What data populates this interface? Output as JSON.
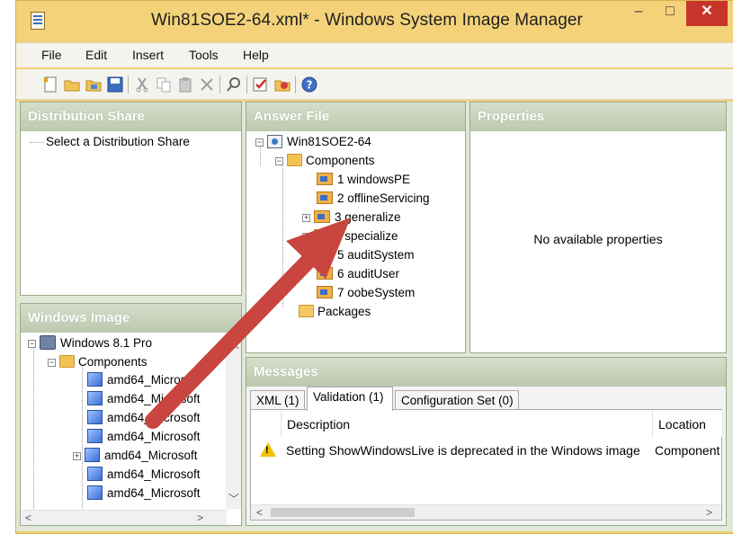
{
  "window": {
    "title": "Win81SOE2-64.xml* - Windows System Image Manager",
    "controls": {
      "minimize": "–",
      "maximize": "□",
      "close": "✕"
    }
  },
  "menu": [
    "File",
    "Edit",
    "Insert",
    "Tools",
    "Help"
  ],
  "toolbar": {
    "icons": [
      "new-answer-file-icon",
      "open-answer-file-icon",
      "open-distribution-share-icon",
      "save-icon",
      "cut-icon",
      "copy-icon",
      "paste-icon",
      "delete-icon",
      "find-icon",
      "validate-icon",
      "create-configuration-set-icon",
      "help-icon"
    ]
  },
  "distribution_share": {
    "header": "Distribution Share",
    "item": "Select a Distribution Share"
  },
  "windows_image": {
    "header": "Windows Image",
    "root": "Windows 8.1 Pro",
    "components_label": "Components",
    "items": [
      "amd64_Microsoft",
      "amd64_Microsoft",
      "amd64_Microsoft",
      "amd64_Microsoft",
      "amd64_Microsoft",
      "amd64_Microsoft",
      "amd64_Microsoft"
    ]
  },
  "answer_file": {
    "header": "Answer File",
    "root": "Win81SOE2-64",
    "components_label": "Components",
    "passes": [
      "1 windowsPE",
      "2 offlineServicing",
      "3 generalize",
      "4 specialize",
      "5 auditSystem",
      "6 auditUser",
      "7 oobeSystem"
    ],
    "packages_label": "Packages"
  },
  "properties": {
    "header": "Properties",
    "empty_text": "No available properties"
  },
  "messages": {
    "header": "Messages",
    "tabs": [
      "XML (1)",
      "Validation (1)",
      "Configuration Set (0)"
    ],
    "active_tab": "Validation (1)",
    "columns": [
      "Description",
      "Location"
    ],
    "rows": [
      {
        "description": "Setting ShowWindowsLive is deprecated in the Windows image",
        "location": "Component"
      }
    ]
  },
  "colors": {
    "title_bar": "#f3d27a",
    "panel_header": "#c5d0b8",
    "close_button": "#c7352a",
    "annotation_arrow": "#c9453f"
  }
}
